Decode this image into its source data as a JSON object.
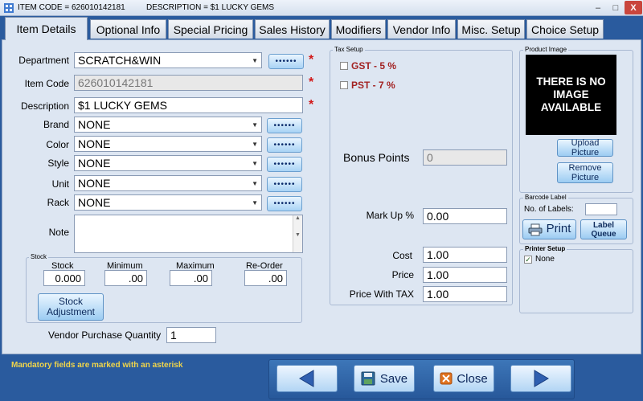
{
  "titlebar": {
    "item_code": "ITEM CODE  =  626010142181",
    "description": "DESCRIPTION = $1 LUCKY GEMS",
    "min_label": "–",
    "max_label": "□",
    "close_label": "X"
  },
  "tabs": [
    {
      "label": "Item Details",
      "active": true
    },
    {
      "label": "Optional Info"
    },
    {
      "label": "Special Pricing"
    },
    {
      "label": "Sales History"
    },
    {
      "label": "Modifiers"
    },
    {
      "label": "Vendor Info"
    },
    {
      "label": "Misc. Setup"
    },
    {
      "label": "Choice Setup"
    }
  ],
  "form": {
    "department": {
      "label": "Department",
      "value": "SCRATCH&WIN"
    },
    "item_code": {
      "label": "Item Code",
      "value": "626010142181"
    },
    "description": {
      "label": "Description",
      "value": "$1 LUCKY GEMS"
    },
    "brand": {
      "label": "Brand",
      "value": "NONE"
    },
    "color": {
      "label": "Color",
      "value": "NONE"
    },
    "style": {
      "label": "Style",
      "value": "NONE"
    },
    "unit": {
      "label": "Unit",
      "value": "NONE"
    },
    "rack": {
      "label": "Rack",
      "value": "NONE"
    },
    "note": {
      "label": "Note",
      "value": ""
    },
    "dots_label": "••••••",
    "asterisk": "*",
    "vendor_qty": {
      "label": "Vendor Purchase Quantity",
      "value": "1"
    }
  },
  "stock": {
    "title": "Stock",
    "stock": {
      "label": "Stock",
      "value": "0.000"
    },
    "minimum": {
      "label": "Minimum",
      "value": ".00"
    },
    "maximum": {
      "label": "Maximum",
      "value": ".00"
    },
    "reorder": {
      "label": "Re-Order",
      "value": ".00"
    },
    "adjust_button": "Stock Adjustment"
  },
  "tax": {
    "title": "Tax Setup",
    "gst": "GST -  5  %",
    "pst": "PST -  7  %"
  },
  "pricing": {
    "bonus_points": {
      "label": "Bonus Points",
      "value": "0"
    },
    "markup": {
      "label": "Mark Up %",
      "value": "0.00"
    },
    "cost": {
      "label": "Cost",
      "value": "1.00"
    },
    "price": {
      "label": "Price",
      "value": "1.00"
    },
    "price_tax": {
      "label": "Price With TAX",
      "value": "1.00"
    }
  },
  "product_image": {
    "title": "Product Image",
    "placeholder": "THERE IS NO IMAGE AVAILABLE",
    "upload_button": "Upload Picture",
    "remove_button": "Remove Picture"
  },
  "barcode": {
    "title": "Barcode Label",
    "labels_label": "No. of Labels:",
    "labels_value": "",
    "print_button": "Print",
    "queue_button": "Label Queue"
  },
  "printer": {
    "title": "Printer Setup",
    "none_label": "None"
  },
  "footer": {
    "mandatory_note": "Mandatory fields are marked with an asterisk",
    "save_button": "Save",
    "close_button": "Close"
  },
  "colors": {
    "background": "#2a5b9e",
    "panel": "#dde6f2",
    "asterisk": "#d21818",
    "tax_text": "#a32323",
    "mandatory_note": "#f0d54a"
  }
}
